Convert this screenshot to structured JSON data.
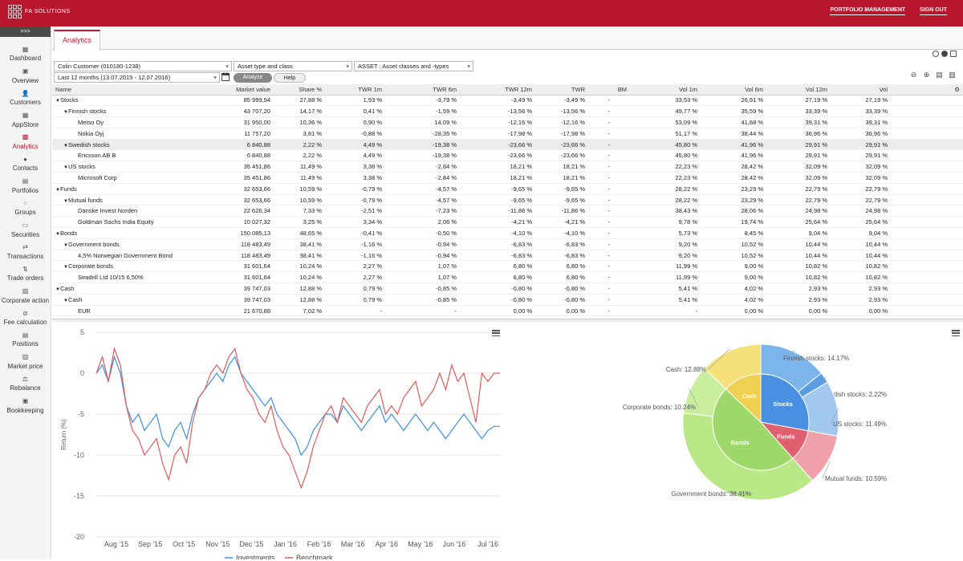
{
  "header": {
    "logo_text": "FA SOLUTIONS",
    "nav": [
      "PORTFOLIO MANAGEMENT",
      "SIGN OUT"
    ]
  },
  "sidebar": {
    "toggle": ">>>",
    "items": [
      {
        "label": "Dashboard",
        "icon": "dashboard-icon"
      },
      {
        "label": "Overview",
        "icon": "overview-icon"
      },
      {
        "label": "Customers",
        "icon": "customers-icon"
      },
      {
        "label": "AppStore",
        "icon": "appstore-icon"
      },
      {
        "label": "Analytics",
        "icon": "analytics-icon"
      },
      {
        "label": "Contacts",
        "icon": "contacts-icon"
      },
      {
        "label": "Portfolios",
        "icon": "portfolios-icon"
      },
      {
        "label": "Groups",
        "icon": "groups-icon"
      },
      {
        "label": "Securities",
        "icon": "securities-icon"
      },
      {
        "label": "Transactions",
        "icon": "transactions-icon"
      },
      {
        "label": "Trade orders",
        "icon": "trade-orders-icon"
      },
      {
        "label": "Corporate action",
        "icon": "corporate-action-icon"
      },
      {
        "label": "Fee calculation",
        "icon": "fee-calculation-icon"
      },
      {
        "label": "Positions",
        "icon": "positions-icon"
      },
      {
        "label": "Market price",
        "icon": "market-price-icon"
      },
      {
        "label": "Rebalance",
        "icon": "rebalance-icon"
      },
      {
        "label": "Bookkeeping",
        "icon": "bookkeeping-icon"
      }
    ]
  },
  "tab": "Analytics",
  "filters": {
    "customer": "Colin Customer (010180-1238)",
    "asset": "Asset type and class",
    "classes": "ASSET : Asset classes and -types",
    "period": "Last 12 months (13.07.2015 - 12.07.2016)",
    "analyze": "Analyze",
    "help": "Help"
  },
  "table": {
    "headers": [
      "Name",
      "Market value",
      "Share %",
      "TWR 1m",
      "TWR 6m",
      "TWR 12m",
      "TWR",
      "BM",
      "Vol 1m",
      "Vol 6m",
      "Vol 12m",
      "Vol"
    ],
    "rows": [
      {
        "l": 0,
        "e": true,
        "c": [
          "Stocks",
          "85 999,94",
          "27,88 %",
          "1,93 %",
          "-3,79 %",
          "-3,49 %",
          "-3,49 %",
          "-",
          "33,53 %",
          "26,91 %",
          "27,19 %",
          "27,19 %"
        ]
      },
      {
        "l": 1,
        "e": true,
        "c": [
          "Finnish stocks",
          "43 707,20",
          "14,17 %",
          "0,41 %",
          "-1,59 %",
          "-13,56 %",
          "-13,56 %",
          "-",
          "49,77 %",
          "35,59 %",
          "33,39 %",
          "33,39 %"
        ]
      },
      {
        "l": 2,
        "c": [
          "Metso Oy",
          "31 950,00",
          "10,36 %",
          "0,90 %",
          "14,09 %",
          "-12,16 %",
          "-12,16 %",
          "-",
          "53,09 %",
          "41,68 %",
          "39,31 %",
          "39,31 %"
        ]
      },
      {
        "l": 2,
        "c": [
          "Nokia Oyj",
          "11 757,20",
          "3,81 %",
          "-0,88 %",
          "-28,35 %",
          "-17,98 %",
          "-17,98 %",
          "-",
          "51,17 %",
          "38,44 %",
          "36,96 %",
          "36,96 %"
        ]
      },
      {
        "l": 1,
        "e": true,
        "h": true,
        "c": [
          "Swedish stocks",
          "6 840,88",
          "2,22 %",
          "4,49 %",
          "-19,38 %",
          "-23,66 %",
          "-23,66 %",
          "-",
          "45,80 %",
          "41,96 %",
          "29,91 %",
          "29,91 %"
        ]
      },
      {
        "l": 2,
        "c": [
          "Ericsson AB B",
          "6 840,88",
          "2,22 %",
          "4,49 %",
          "-19,38 %",
          "-23,66 %",
          "-23,66 %",
          "-",
          "45,80 %",
          "41,96 %",
          "29,91 %",
          "29,91 %"
        ]
      },
      {
        "l": 1,
        "e": true,
        "c": [
          "US stocks",
          "35 451,86",
          "11,49 %",
          "3,38 %",
          "-2,84 %",
          "18,21 %",
          "18,21 %",
          "-",
          "22,23 %",
          "28,42 %",
          "32,09 %",
          "32,09 %"
        ]
      },
      {
        "l": 2,
        "c": [
          "Microsoft Corp",
          "35 451,86",
          "11,49 %",
          "3,38 %",
          "-2,84 %",
          "18,21 %",
          "18,21 %",
          "-",
          "22,23 %",
          "28,42 %",
          "32,09 %",
          "32,09 %"
        ]
      },
      {
        "l": 0,
        "e": true,
        "c": [
          "Funds",
          "32 653,66",
          "10,59 %",
          "-0,79 %",
          "-4,57 %",
          "-9,65 %",
          "-9,65 %",
          "-",
          "28,22 %",
          "23,29 %",
          "22,79 %",
          "22,79 %"
        ]
      },
      {
        "l": 1,
        "e": true,
        "c": [
          "Mutual funds",
          "32 653,66",
          "10,59 %",
          "-0,79 %",
          "-4,57 %",
          "-9,65 %",
          "-9,65 %",
          "-",
          "28,22 %",
          "23,29 %",
          "22,79 %",
          "22,79 %"
        ]
      },
      {
        "l": 2,
        "c": [
          "Danske Invest Norden",
          "22 626,34",
          "7,33 %",
          "-2,51 %",
          "-7,23 %",
          "-11,86 %",
          "-11,86 %",
          "-",
          "38,43 %",
          "28,06 %",
          "24,98 %",
          "24,98 %"
        ]
      },
      {
        "l": 2,
        "c": [
          "Goldman Sachs India Equity",
          "10 027,32",
          "3,25 %",
          "3,34 %",
          "2,06 %",
          "-4,21 %",
          "-4,21 %",
          "-",
          "9,78 %",
          "19,74 %",
          "25,64 %",
          "25,64 %"
        ]
      },
      {
        "l": 0,
        "e": true,
        "c": [
          "Bonds",
          "150 085,13",
          "48,65 %",
          "-0,41 %",
          "-0,50 %",
          "-4,10 %",
          "-4,10 %",
          "-",
          "5,73 %",
          "8,45 %",
          "9,04 %",
          "9,04 %"
        ]
      },
      {
        "l": 1,
        "e": true,
        "c": [
          "Government bonds",
          "118 483,49",
          "38,41 %",
          "-1,16 %",
          "-0,94 %",
          "-6,83 %",
          "-6,83 %",
          "-",
          "9,20 %",
          "10,52 %",
          "10,44 %",
          "10,44 %"
        ]
      },
      {
        "l": 2,
        "c": [
          "4,5% Norwegian Government Bond",
          "118 483,49",
          "38,41 %",
          "-1,16 %",
          "-0,94 %",
          "-6,83 %",
          "-6,83 %",
          "-",
          "9,20 %",
          "10,52 %",
          "10,44 %",
          "10,44 %"
        ]
      },
      {
        "l": 1,
        "e": true,
        "c": [
          "Corporate bonds",
          "31 601,64",
          "10,24 %",
          "2,27 %",
          "1,07 %",
          "6,80 %",
          "6,80 %",
          "-",
          "11,99 %",
          "9,00 %",
          "10,82 %",
          "10,82 %"
        ]
      },
      {
        "l": 2,
        "c": [
          "Seadrill Ltd 10/15 6,50%",
          "31 601,64",
          "10,24 %",
          "2,27 %",
          "1,07 %",
          "6,80 %",
          "6,80 %",
          "-",
          "11,99 %",
          "9,00 %",
          "10,82 %",
          "10,82 %"
        ]
      },
      {
        "l": 0,
        "e": true,
        "c": [
          "Cash",
          "39 747,03",
          "12,88 %",
          "0,79 %",
          "-0,85 %",
          "-0,80 %",
          "-0,80 %",
          "-",
          "5,41 %",
          "4,02 %",
          "2,93 %",
          "2,93 %"
        ]
      },
      {
        "l": 1,
        "e": true,
        "c": [
          "Cash",
          "39 747,03",
          "12,88 %",
          "0,79 %",
          "-0,85 %",
          "-0,80 %",
          "-0,80 %",
          "-",
          "5,41 %",
          "4,02 %",
          "2,93 %",
          "2,93 %"
        ]
      },
      {
        "l": 2,
        "c": [
          "EUR",
          "21 670,88",
          "7,02 %",
          "-",
          "-",
          "0,00 %",
          "0,00 %",
          "-",
          "-",
          "0,00 %",
          "0,00 %",
          "0,00 %"
        ]
      }
    ]
  },
  "chart_data": [
    {
      "type": "line",
      "ylabel": "Return (%)",
      "ylim": [
        -20,
        5
      ],
      "yticks": [
        5,
        0,
        -5,
        -10,
        -15,
        -20
      ],
      "xticks": [
        "Aug '15",
        "Sep '15",
        "Oct '15",
        "Nov '15",
        "Dec '15",
        "Jan '16",
        "Feb '16",
        "Mar '16",
        "Apr '16",
        "May '16",
        "Jun '16",
        "Jul '16"
      ],
      "colors": {
        "investments": "#3b8fe0",
        "benchmark": "#e05a5a"
      },
      "series": [
        {
          "name": "Investments",
          "values": [
            0,
            1,
            -1,
            2,
            0,
            -4,
            -6,
            -5,
            -7,
            -6,
            -5,
            -8,
            -9,
            -7,
            -6,
            -8,
            -5,
            -3,
            -2,
            -1,
            0,
            -1,
            1,
            2,
            0,
            -1,
            -2,
            -3,
            -4,
            -3,
            -5,
            -6,
            -7,
            -8,
            -10,
            -9,
            -7,
            -6,
            -5,
            -5,
            -6,
            -4,
            -5,
            -6,
            -7,
            -6,
            -5,
            -4,
            -6,
            -5,
            -6,
            -7,
            -6,
            -5,
            -6,
            -7,
            -6,
            -7,
            -8,
            -7,
            -6,
            -5,
            -6,
            -7,
            -8,
            -7,
            -6.5,
            -6.5
          ]
        },
        {
          "name": "Benchmark",
          "values": [
            0,
            2,
            -1,
            3,
            1,
            -4,
            -7,
            -8,
            -10,
            -9,
            -8,
            -11,
            -13,
            -10,
            -9,
            -11,
            -6,
            -3,
            -2,
            0,
            1,
            0,
            2,
            3,
            0,
            -2,
            -3,
            -5,
            -6,
            -4,
            -7,
            -9,
            -10,
            -12,
            -14,
            -12,
            -9,
            -7,
            -5,
            -4,
            -6,
            -3,
            -4,
            -5,
            -6,
            -4,
            -3,
            -2,
            -5,
            -4,
            -5,
            -3,
            -2,
            -1,
            -4,
            -3,
            -2,
            0,
            -2,
            1,
            -1,
            0,
            -3,
            -6,
            0,
            -1,
            0,
            0
          ]
        }
      ]
    },
    {
      "type": "pie",
      "title": "",
      "outer": [
        {
          "label": "Finnish stocks: 14.17%",
          "value": 14.17,
          "color": "#7cb5ec"
        },
        {
          "label": "Swedish stocks: 2.22%",
          "value": 2.22,
          "color": "#5b9ee0"
        },
        {
          "label": "US stocks: 11.49%",
          "value": 11.49,
          "color": "#a3c8f0"
        },
        {
          "label": "Mutual funds: 10.59%",
          "value": 10.59,
          "color": "#f0a0a8"
        },
        {
          "label": "Government bonds: 38.41%",
          "value": 38.41,
          "color": "#b8e986"
        },
        {
          "label": "Corporate bonds: 10.24%",
          "value": 10.24,
          "color": "#c8ee9e"
        },
        {
          "label": "Cash: 12.88%",
          "value": 12.88,
          "color": "#f5e07a"
        }
      ],
      "inner": [
        {
          "label": "Stocks",
          "value": 27.88,
          "color": "#4a90e2"
        },
        {
          "label": "Funds",
          "value": 10.59,
          "color": "#e06070"
        },
        {
          "label": "Bonds",
          "value": 48.65,
          "color": "#9ed86a"
        },
        {
          "label": "Cash",
          "value": 12.88,
          "color": "#f0d050"
        }
      ]
    }
  ]
}
